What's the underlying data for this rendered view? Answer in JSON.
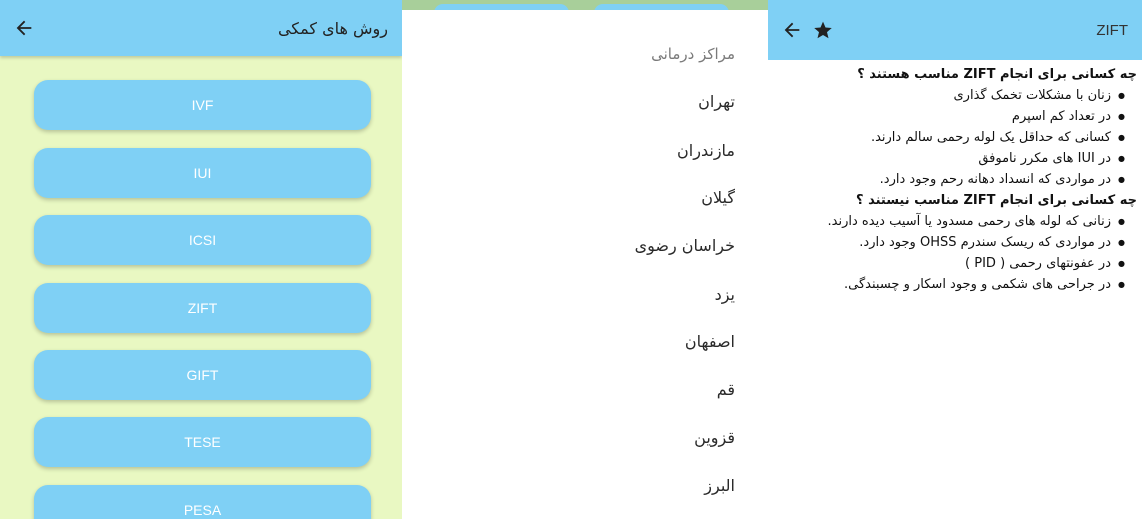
{
  "panel1": {
    "title": "روش های کمکی",
    "methods": [
      {
        "label": "IVF"
      },
      {
        "label": "IUI"
      },
      {
        "label": "ICSI"
      },
      {
        "label": "ZIFT"
      },
      {
        "label": "GIFT"
      },
      {
        "label": "TESE"
      },
      {
        "label": "PESA"
      }
    ]
  },
  "panel2": {
    "header": "مراکز درمانی",
    "cities": [
      "تهران",
      "مازندران",
      "گیلان",
      "خراسان رضوی",
      "یزد",
      "اصفهان",
      "قم",
      "قزوین",
      "البرز"
    ]
  },
  "panel3": {
    "title": "ZIFT",
    "suitable_heading": "چه کسانی برای انجام ZIFT مناسب هستند ؟",
    "suitable": [
      "زنان با مشکلات تخمک گذاری",
      "در تعداد کم اسپرم",
      "کسانی که حداقل یک لوله رحمی سالم دارند.",
      "در IUI  های مکرر ناموفق",
      "در مواردی که انسداد دهانه رحم وجود دارد."
    ],
    "unsuitable_heading": "چه کسانی برای انجام ZIFT مناسب نیستند ؟",
    "unsuitable": [
      "زنانی که لوله های رحمی مسدود یا آسیب دیده دارند.",
      "در مواردی که ریسک سندرم OHSS وجود دارد.",
      "در عفونتهای رحمی ( PID )",
      "در جراحی های شکمی و وجود اسکار و چسبندگی."
    ]
  }
}
